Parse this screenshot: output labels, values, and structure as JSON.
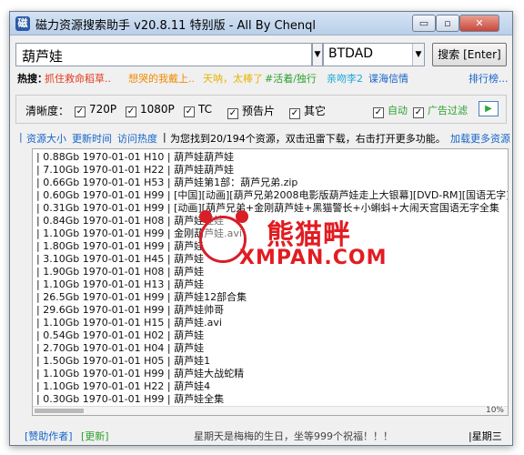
{
  "window": {
    "title": "磁力资源搜索助手 v20.8.11 特别版 - All By Chenql",
    "min_glyph": "▭",
    "max_glyph": "▫",
    "close_glyph": "✕"
  },
  "search": {
    "query": "葫芦娃",
    "engine": "BTDAD",
    "dropdown_glyph": "▼",
    "button_label": "搜索 [Enter]"
  },
  "hot": {
    "label": "热搜：",
    "items": [
      {
        "text": "抓住救命稻草..",
        "color": "#e23a1c"
      },
      {
        "text": "想哭的我戴上..",
        "color": "#f08a00"
      },
      {
        "text": "天呐，太棒了",
        "color": "#e6b400"
      },
      {
        "text": "#活着/独行",
        "color": "#2ea12f"
      },
      {
        "text": "亲吻李2",
        "color": "#18a9d6"
      },
      {
        "text": "谍海信情",
        "color": "#1764c9"
      }
    ],
    "more": "排行榜..."
  },
  "filters": {
    "label": "清晰度：",
    "options": [
      {
        "label": "720P",
        "checked": true
      },
      {
        "label": "1080P",
        "checked": true
      },
      {
        "label": "TC",
        "checked": true
      },
      {
        "label": "预告片",
        "checked": true
      },
      {
        "label": "其它",
        "checked": true
      }
    ],
    "auto": {
      "label": "自动",
      "checked": true
    },
    "ad_filter": {
      "label": "广告过滤",
      "checked": true
    },
    "check_mark": "✓",
    "play_glyph": "▶"
  },
  "info": {
    "sort_size": "资源大小",
    "sort_time": "更新时间",
    "sort_hot": "访问热度",
    "summary": "为您找到20/194个资源，双击迅雷下载，右击打开更多功能。",
    "load_more": "加载更多资源",
    "sep_left": "|",
    "sep_mid": "|"
  },
  "results": [
    "| 0.88Gb 1970-01-01 H10 | 葫芦娃葫芦娃",
    "| 7.10Gb 1970-01-01 H22 | 葫芦娃葫芦娃",
    "| 0.66Gb 1970-01-01 H53 | 葫芦娃第1部：葫芦兄弟.zip",
    "| 0.60Gb 1970-01-01 H99 | [中国][动画][葫芦兄弟2008电影版葫芦娃走上大银幕][DVD-RM][国语无字]",
    "| 0.31Gb 1970-01-01 H99 | [动画][葫芦兄弟+金刚葫芦娃+黑猫警长+小蝌蚪+大闹天宫国语无字全集",
    "| 0.84Gb 1970-01-01 H08 | 葫芦娃娃娃",
    "| 1.10Gb 1970-01-01 H99 | 金刚葫芦娃.avi",
    "| 1.80Gb 1970-01-01 H99 | 葫芦娃",
    "| 3.10Gb 1970-01-01 H45 | 葫芦娃",
    "| 1.90Gb 1970-01-01 H08 | 葫芦娃",
    "| 1.10Gb 1970-01-01 H13 | 葫芦娃",
    "| 26.5Gb 1970-01-01 H99 | 葫芦娃12部合集",
    "| 29.6Gb 1970-01-01 H99 | 葫芦娃帅哥",
    "| 1.10Gb 1970-01-01 H15 | 葫芦娃.avi",
    "| 0.54Gb 1970-01-01 H02 | 葫芦娃",
    "| 2.70Gb 1970-01-01 H04 | 葫芦娃",
    "| 1.50Gb 1970-01-01 H05 | 葫芦娃1",
    "| 1.10Gb 1970-01-01 H99 | 葫芦娃大战蛇精",
    "| 1.10Gb 1970-01-01 H22 | 葫芦娃4",
    "| 0.30Gb 1970-01-01 H99 | 葫芦娃全集"
  ],
  "progress": {
    "text": "10%",
    "fraction": 0.1
  },
  "watermark": {
    "cn": "熊猫畔",
    "en": "XMPAN.COM"
  },
  "status": {
    "donate": "[赞助作者]",
    "update": "[更新]",
    "message": "星期天是梅梅的生日，坐等999个祝福！！！",
    "weekday": "|星期三"
  }
}
